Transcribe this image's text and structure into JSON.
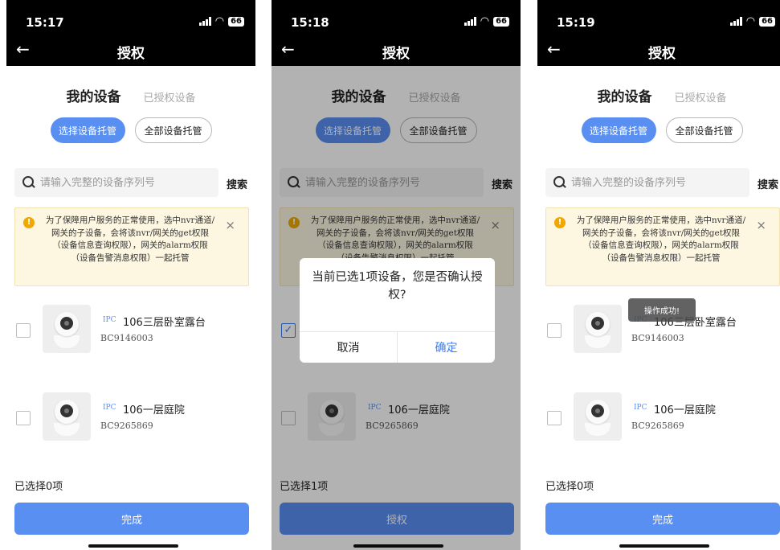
{
  "status_icons": {
    "signal": "signal-bars-icon",
    "wifi": "wifi-icon",
    "battery": "66"
  },
  "nav": {
    "back": "←",
    "title": "授权"
  },
  "tabs": {
    "my_devices": "我的设备",
    "authorized": "已授权设备"
  },
  "mode": {
    "select": "选择设备托管",
    "all": "全部设备托管"
  },
  "search": {
    "placeholder": "请输入完整的设备序列号",
    "button": "搜索"
  },
  "notice": {
    "icon": "!",
    "text": "为了保障用户服务的正常使用，选中nvr通道/网关的子设备，会将该nvr/网关的get权限（设备信息查询权限），网关的alarm权限（设备告警消息权限）一起托管",
    "close": "×"
  },
  "devices": [
    {
      "tag": "IPC",
      "name": "106三层卧室露台",
      "serial": "BC9146003"
    },
    {
      "tag": "IPC",
      "name": "106一层庭院",
      "serial": "BC9265869"
    }
  ],
  "screens": [
    {
      "time": "15:17",
      "selected_text": "已选择0项",
      "button": "完成",
      "checked": [
        false,
        false
      ]
    },
    {
      "time": "15:18",
      "selected_text": "已选择1项",
      "button": "授权",
      "checked": [
        true,
        false
      ]
    },
    {
      "time": "15:19",
      "selected_text": "已选择0项",
      "button": "完成",
      "checked": [
        false,
        false
      ]
    }
  ],
  "dialog": {
    "message": "当前已选1项设备，您是否确认授权?",
    "cancel": "取消",
    "confirm": "确定"
  },
  "toast": {
    "message": "操作成功!"
  },
  "colors": {
    "accent": "#5a8ff2",
    "notice_bg": "#fdf6e1",
    "notice_icon": "#f0a800"
  }
}
